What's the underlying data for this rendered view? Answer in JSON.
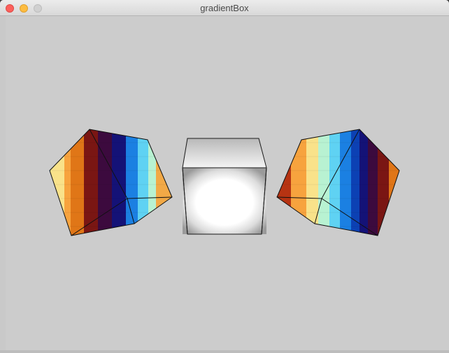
{
  "window": {
    "title": "gradientBox"
  },
  "titlebar_buttons": {
    "close_icon": "close-icon",
    "minimize_icon": "minimize-icon",
    "zoom_icon": "zoom-icon"
  },
  "scene": {
    "background_color": "#cccccc",
    "left_cube_colormap": [
      "#63e4f7",
      "#f9e28a",
      "#f7a33e",
      "#e07617",
      "#7a1613",
      "#3c0a3e",
      "#141277",
      "#0c41b4",
      "#1b80e2",
      "#5fd2f3",
      "#b8f2d2",
      "#f2a946"
    ],
    "center_cube": {
      "edge_color": "#1a1a1a",
      "gradient": [
        "#ffffff",
        "#9c9c9c"
      ]
    },
    "right_cube_colormap": [
      "#3c0a3e",
      "#b63312",
      "#f7a33e",
      "#f9e28a",
      "#b8f2d2",
      "#5fd2f3",
      "#1b80e2",
      "#0c41b4",
      "#141277",
      "#3c0a3e",
      "#7a1613",
      "#e07617"
    ]
  }
}
